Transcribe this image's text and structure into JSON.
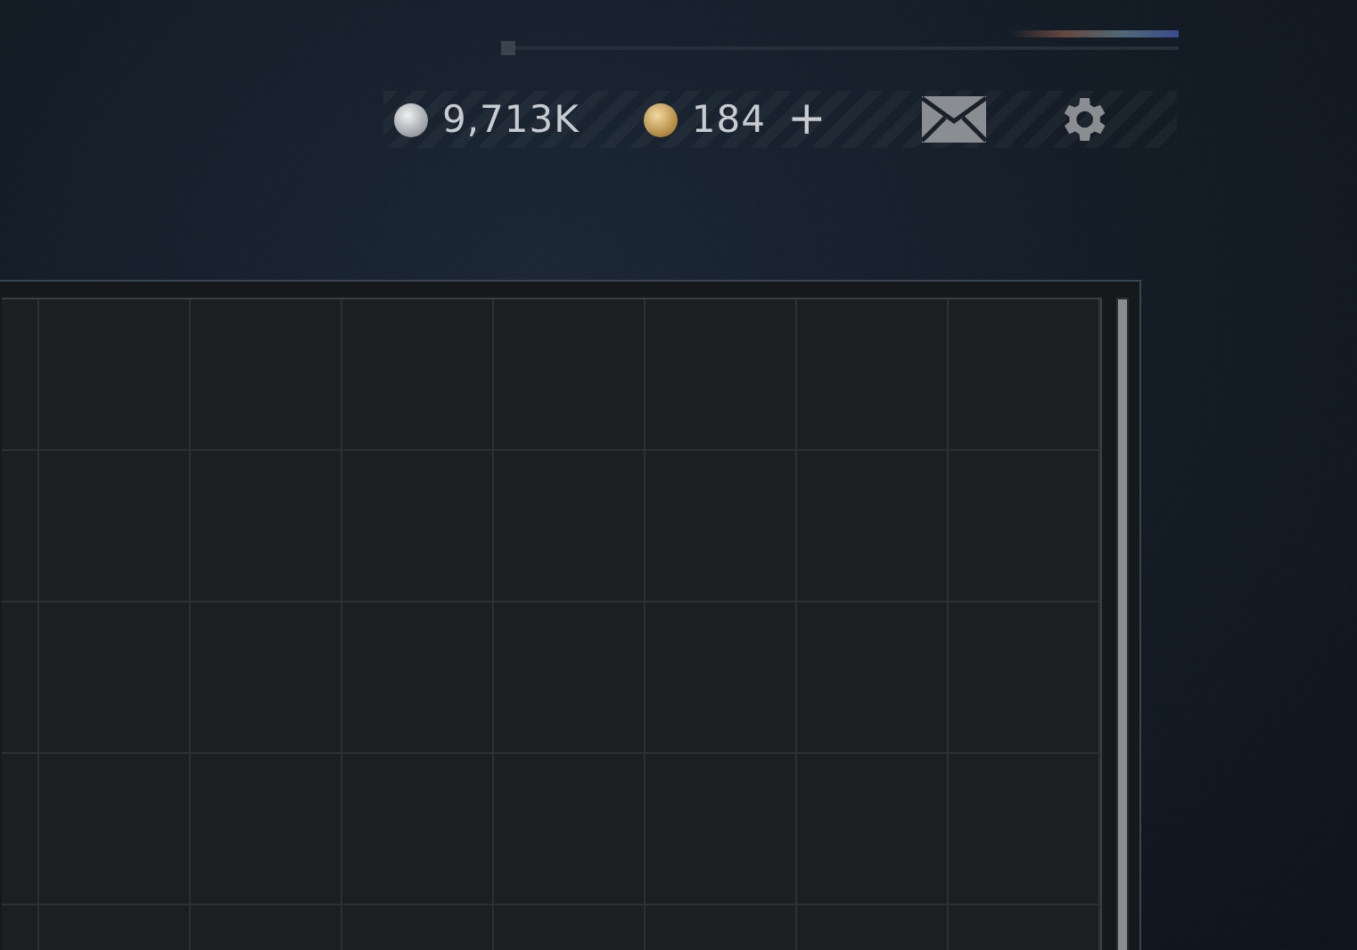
{
  "currencies": [
    {
      "kind": "silver",
      "amount": "9,713K"
    },
    {
      "kind": "gold",
      "amount": "184",
      "add_label": "+"
    }
  ]
}
